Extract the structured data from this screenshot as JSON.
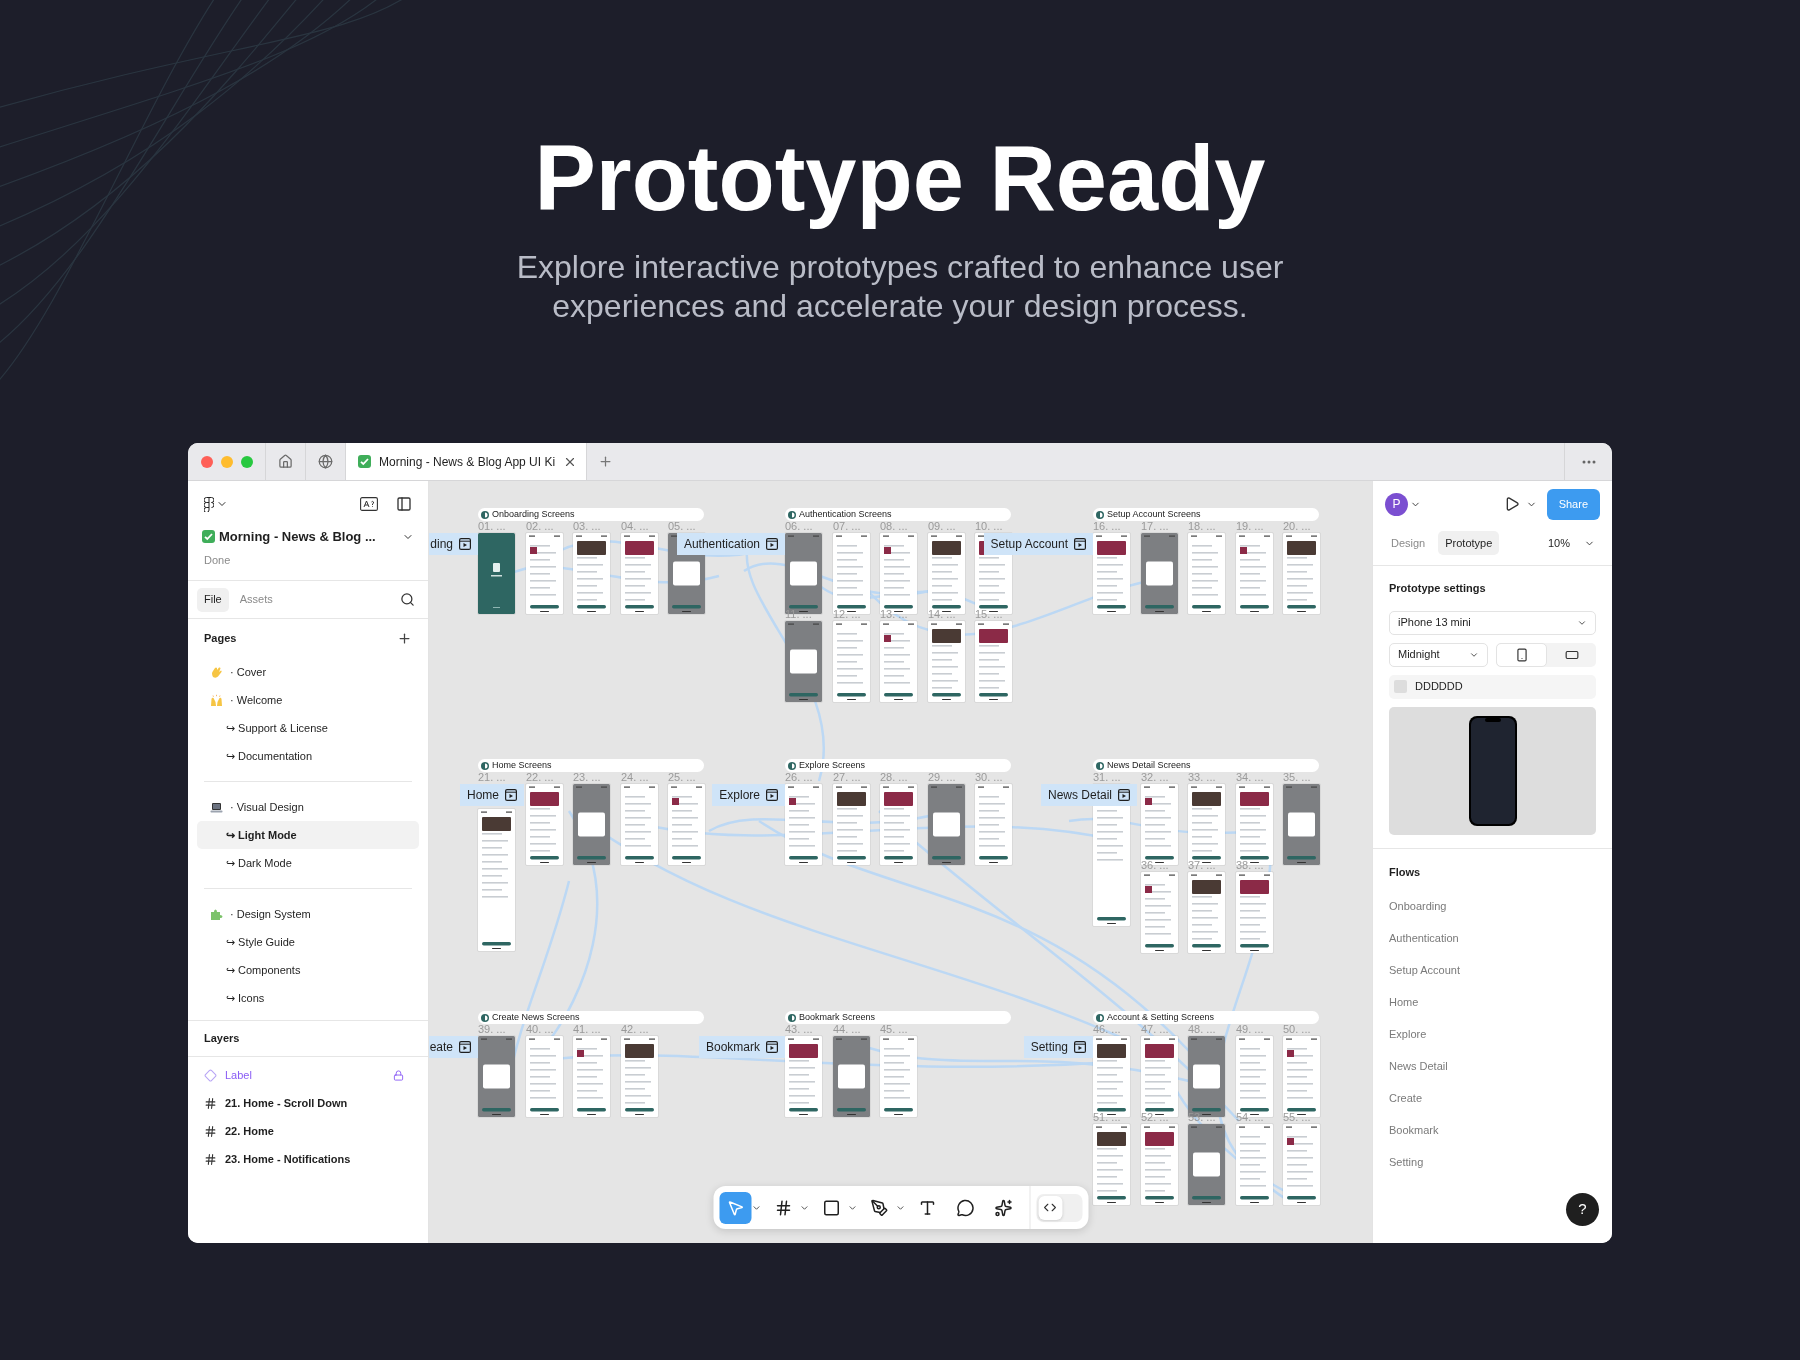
{
  "hero": {
    "title": "Prototype Ready",
    "subtitle": "Explore interactive prototypes crafted to enhance user experiences and accelerate your design process."
  },
  "window": {
    "tabs": [
      {
        "title": "Morning - News & Blog App UI Ki",
        "selected": true
      }
    ]
  },
  "left_panel": {
    "file_name": "Morning - News & Blog ...",
    "status": "Done",
    "tabs": [
      {
        "label": "File",
        "selected": true
      },
      {
        "label": "Assets",
        "selected": false
      }
    ],
    "pages_title": "Pages",
    "page_groups": [
      {
        "pages": [
          {
            "kind": "wave",
            "name": "· Cover",
            "selected": false
          },
          {
            "kind": "hands",
            "name": "· Welcome",
            "selected": false,
            "children": [
              {
                "name": "↪ Support & License",
                "selected": false
              },
              {
                "name": "↪ Documentation",
                "selected": false
              }
            ]
          }
        ]
      },
      {
        "pages": [
          {
            "kind": "laptop",
            "name": "· Visual Design",
            "selected": false,
            "children": [
              {
                "name": "↪ Light Mode",
                "selected": true
              },
              {
                "name": "↪ Dark Mode",
                "selected": false
              }
            ]
          }
        ]
      },
      {
        "pages": [
          {
            "kind": "puzzle",
            "name": "· Design System",
            "selected": false,
            "children": [
              {
                "name": "↪ Style Guide",
                "selected": false
              },
              {
                "name": "↪ Components",
                "selected": false
              },
              {
                "name": "↪ Icons",
                "selected": false
              }
            ]
          }
        ]
      }
    ],
    "layers_title": "Layers",
    "layers": [
      {
        "kind": "component",
        "name": "Label",
        "locked": true
      },
      {
        "kind": "frame",
        "name": "21. Home - Scroll Down",
        "locked": false
      },
      {
        "kind": "frame",
        "name": "22. Home",
        "locked": false
      },
      {
        "kind": "frame",
        "name": "23. Home - Notifications",
        "locked": false
      }
    ]
  },
  "canvas": {
    "sections": [
      {
        "title": "Onboarding Screens",
        "flow": "ding",
        "rows": [
          [
            {
              "label": "01. ...",
              "tall": false
            },
            {
              "label": "02. ...",
              "tall": false
            },
            {
              "label": "03. ...",
              "tall": false
            },
            {
              "label": "04. ...",
              "tall": false
            },
            {
              "label": "05. ...",
              "tall": false
            }
          ]
        ]
      },
      {
        "title": "Authentication Screens",
        "flow": "Authentication",
        "rows": [
          [
            {
              "label": "06. ...",
              "tall": false
            },
            {
              "label": "07. ...",
              "tall": false
            },
            {
              "label": "08. ...",
              "tall": false
            },
            {
              "label": "09. ...",
              "tall": false
            },
            {
              "label": "10. ...",
              "tall": false
            }
          ],
          [
            {
              "label": "11. ...",
              "tall": false
            },
            {
              "label": "12. ...",
              "tall": false
            },
            {
              "label": "13. ...",
              "tall": false
            },
            {
              "label": "14. ...",
              "tall": false
            },
            {
              "label": "15. ...",
              "tall": false
            }
          ]
        ]
      },
      {
        "title": "Setup Account Screens",
        "flow": "Setup Account",
        "rows": [
          [
            {
              "label": "16. ...",
              "tall": false
            },
            {
              "label": "17. ...",
              "tall": false
            },
            {
              "label": "18. ...",
              "tall": false
            },
            {
              "label": "19. ...",
              "tall": false
            },
            {
              "label": "20. ...",
              "tall": false
            }
          ]
        ]
      },
      {
        "title": "Home Screens",
        "flow": "Home",
        "rows": [
          [
            {
              "label": "21. ...",
              "tall": true
            },
            {
              "label": "22. ...",
              "tall": false
            },
            {
              "label": "23. ...",
              "tall": false
            },
            {
              "label": "24. ...",
              "tall": false
            },
            {
              "label": "25. ...",
              "tall": false
            }
          ]
        ]
      },
      {
        "title": "Explore Screens",
        "flow": "Explore",
        "rows": [
          [
            {
              "label": "26. ...",
              "tall": false
            },
            {
              "label": "27. ...",
              "tall": false
            },
            {
              "label": "28. ...",
              "tall": false
            },
            {
              "label": "29. ...",
              "tall": false
            },
            {
              "label": "30. ...",
              "tall": false
            }
          ]
        ]
      },
      {
        "title": "News Detail Screens",
        "flow": "News Detail",
        "rows": [
          [
            {
              "label": "31. ...",
              "tall": true
            },
            {
              "label": "32. ...",
              "tall": false
            },
            {
              "label": "33. ...",
              "tall": false
            },
            {
              "label": "34. ...",
              "tall": false
            },
            {
              "label": "35. ...",
              "tall": false
            }
          ],
          [
            "",
            {
              "label": "36. ...",
              "tall": false
            },
            {
              "label": "37. ...",
              "tall": false
            },
            {
              "label": "38. ...",
              "tall": false
            }
          ]
        ]
      },
      {
        "title": "Create News Screens",
        "flow": "eate",
        "rows": [
          [
            {
              "label": "39. ...",
              "tall": false
            },
            {
              "label": "40. ...",
              "tall": false
            },
            {
              "label": "41. ...",
              "tall": false
            },
            {
              "label": "42. ...",
              "tall": false
            }
          ]
        ]
      },
      {
        "title": "Bookmark Screens",
        "flow": "Bookmark",
        "rows": [
          [
            {
              "label": "43. ...",
              "tall": false
            },
            {
              "label": "44. ...",
              "tall": false
            },
            {
              "label": "45. ...",
              "tall": false
            }
          ]
        ]
      },
      {
        "title": "Account & Setting Screens",
        "flow": "Setting",
        "rows": [
          [
            {
              "label": "46. ...",
              "tall": false
            },
            {
              "label": "47. ...",
              "tall": false
            },
            {
              "label": "48. ...",
              "tall": false
            },
            {
              "label": "49. ...",
              "tall": false
            },
            {
              "label": "50. ...",
              "tall": false
            }
          ],
          [
            {
              "label": "51. ...",
              "tall": false
            },
            {
              "label": "52. ...",
              "tall": false
            },
            {
              "label": "53. ...",
              "tall": false
            },
            {
              "label": "54. ...",
              "tall": false
            },
            {
              "label": "55. ...",
              "tall": false
            }
          ]
        ]
      }
    ],
    "toolbar": {
      "tools": [
        {
          "kind": "move",
          "selected": true
        },
        {
          "kind": "frame",
          "selected": false
        },
        {
          "kind": "shape",
          "selected": false
        },
        {
          "kind": "pen",
          "selected": false
        },
        {
          "kind": "text",
          "selected": false
        },
        {
          "kind": "comment",
          "selected": false
        },
        {
          "kind": "ai",
          "selected": false
        }
      ],
      "dev_mode": false
    }
  },
  "right_panel": {
    "avatar": "P",
    "share": "Share",
    "tabs": [
      {
        "label": "Design",
        "selected": false
      },
      {
        "label": "Prototype",
        "selected": true
      }
    ],
    "zoom": "10%",
    "settings_title": "Prototype settings",
    "device": "iPhone 13 mini",
    "model": "Midnight",
    "orientation": [
      {
        "kind": "portrait",
        "selected": true
      },
      {
        "kind": "landscape",
        "selected": false
      }
    ],
    "background": "DDDDDD",
    "flows_title": "Flows",
    "flows": [
      "Onboarding",
      "Authentication",
      "Setup Account",
      "Home",
      "Explore",
      "News Detail",
      "Create",
      "Bookmark",
      "Setting"
    ],
    "help": "?"
  }
}
